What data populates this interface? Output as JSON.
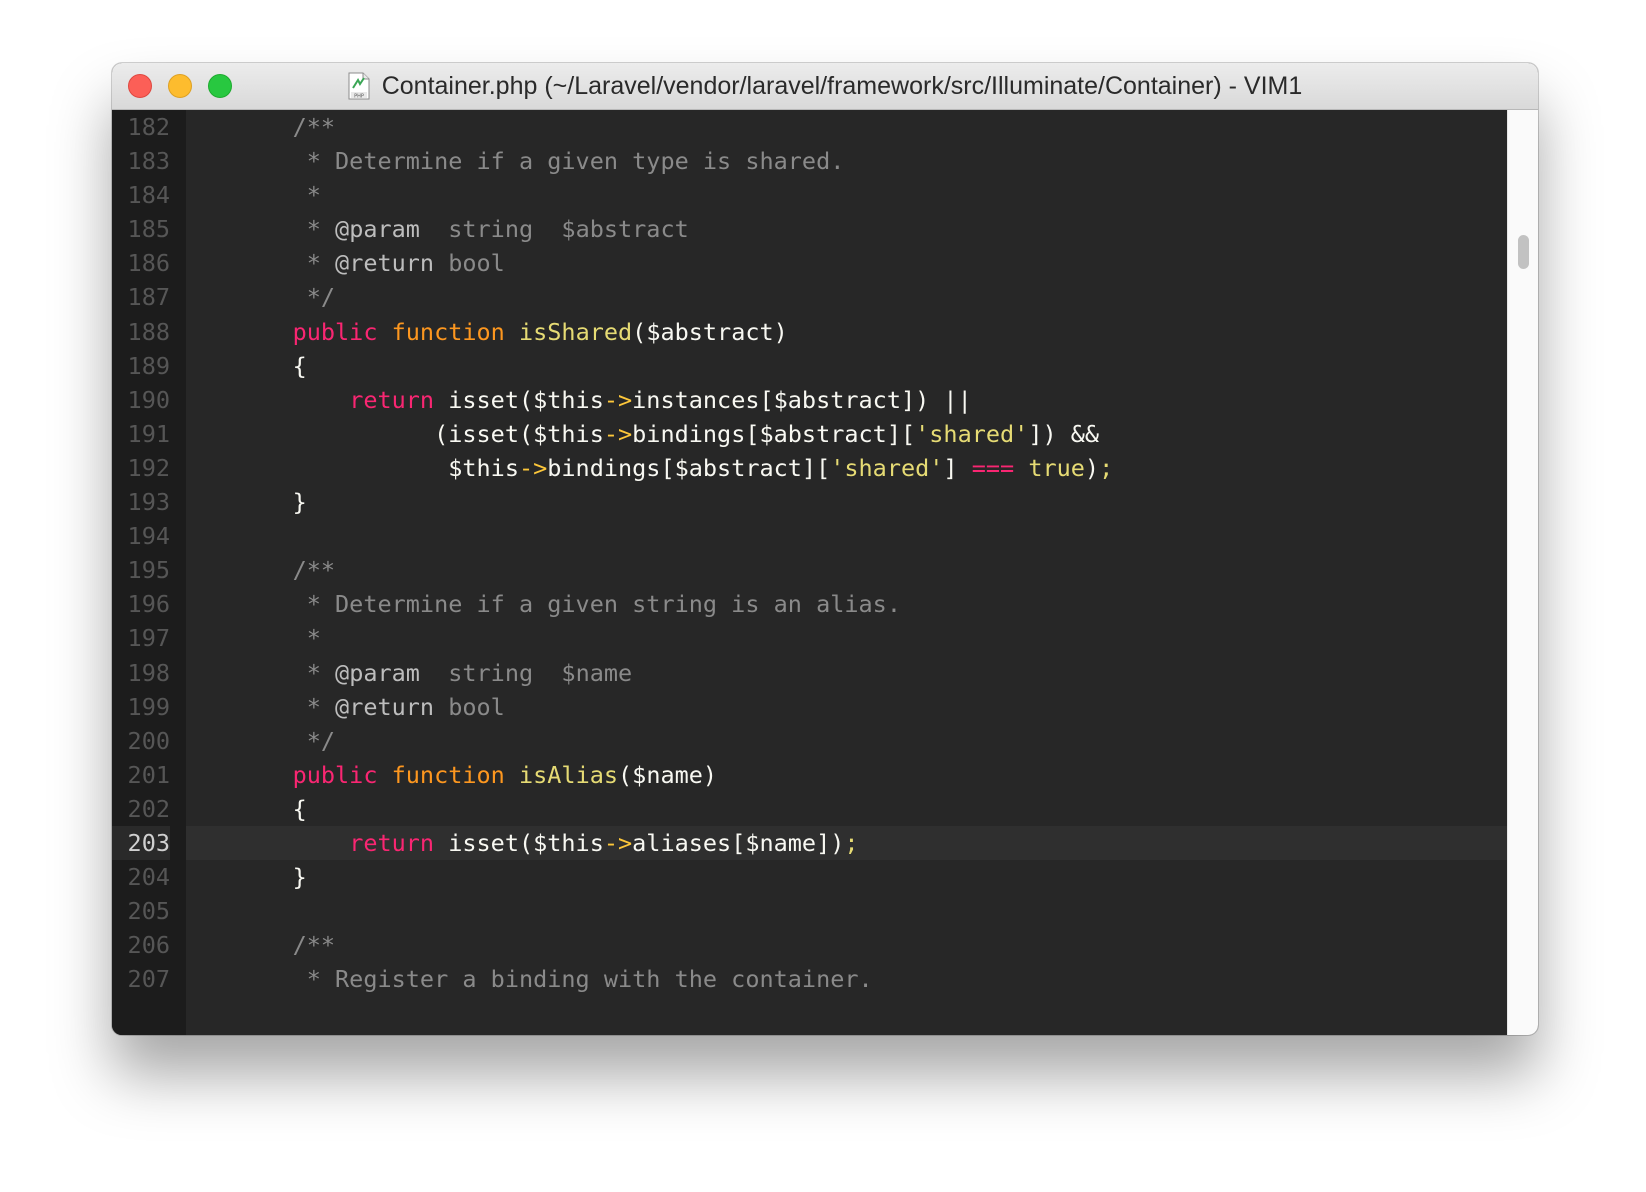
{
  "window": {
    "title": "Container.php (~/Laravel/vendor/laravel/framework/src/Illuminate/Container) - VIM1",
    "file_icon": "php-file-icon"
  },
  "scroll": {
    "position_fraction": 0.14
  },
  "editor": {
    "current_line": 203,
    "lines": [
      {
        "num": "182",
        "tokens": [
          {
            "t": "    /**",
            "c": "comment"
          }
        ]
      },
      {
        "num": "183",
        "tokens": [
          {
            "t": "     * Determine if a given type is shared.",
            "c": "comment"
          }
        ]
      },
      {
        "num": "184",
        "tokens": [
          {
            "t": "     *",
            "c": "comment"
          }
        ]
      },
      {
        "num": "185",
        "tokens": [
          {
            "t": "     * ",
            "c": "comment"
          },
          {
            "t": "@param",
            "c": "doctag"
          },
          {
            "t": "  string  $abstract",
            "c": "comment"
          }
        ]
      },
      {
        "num": "186",
        "tokens": [
          {
            "t": "     * ",
            "c": "comment"
          },
          {
            "t": "@return",
            "c": "doctag"
          },
          {
            "t": " bool",
            "c": "comment"
          }
        ]
      },
      {
        "num": "187",
        "tokens": [
          {
            "t": "     */",
            "c": "comment"
          }
        ]
      },
      {
        "num": "188",
        "tokens": [
          {
            "t": "    ",
            "c": "default"
          },
          {
            "t": "public",
            "c": "keyword"
          },
          {
            "t": " ",
            "c": "default"
          },
          {
            "t": "function",
            "c": "storage"
          },
          {
            "t": " ",
            "c": "default"
          },
          {
            "t": "isShared",
            "c": "funcname"
          },
          {
            "t": "($abstract)",
            "c": "default"
          }
        ]
      },
      {
        "num": "189",
        "tokens": [
          {
            "t": "    {",
            "c": "default"
          }
        ]
      },
      {
        "num": "190",
        "tokens": [
          {
            "t": "        ",
            "c": "default"
          },
          {
            "t": "return",
            "c": "keyword"
          },
          {
            "t": " isset($this",
            "c": "default"
          },
          {
            "t": "->",
            "c": "arrow"
          },
          {
            "t": "instances[$abstract]) ||",
            "c": "default"
          }
        ]
      },
      {
        "num": "191",
        "tokens": [
          {
            "t": "              (isset($this",
            "c": "default"
          },
          {
            "t": "->",
            "c": "arrow"
          },
          {
            "t": "bindings[$abstract][",
            "c": "default"
          },
          {
            "t": "'shared'",
            "c": "string"
          },
          {
            "t": "]) &&",
            "c": "default"
          }
        ]
      },
      {
        "num": "192",
        "tokens": [
          {
            "t": "               $this",
            "c": "default"
          },
          {
            "t": "->",
            "c": "arrow"
          },
          {
            "t": "bindings[$abstract][",
            "c": "default"
          },
          {
            "t": "'shared'",
            "c": "string"
          },
          {
            "t": "] ",
            "c": "default"
          },
          {
            "t": "===",
            "c": "operator"
          },
          {
            "t": " ",
            "c": "default"
          },
          {
            "t": "true",
            "c": "constant"
          },
          {
            "t": ")",
            "c": "default"
          },
          {
            "t": ";",
            "c": "punct-y"
          }
        ]
      },
      {
        "num": "193",
        "tokens": [
          {
            "t": "    }",
            "c": "default"
          }
        ]
      },
      {
        "num": "194",
        "tokens": []
      },
      {
        "num": "195",
        "tokens": [
          {
            "t": "    /**",
            "c": "comment"
          }
        ]
      },
      {
        "num": "196",
        "tokens": [
          {
            "t": "     * Determine if a given string is an alias.",
            "c": "comment"
          }
        ]
      },
      {
        "num": "197",
        "tokens": [
          {
            "t": "     *",
            "c": "comment"
          }
        ]
      },
      {
        "num": "198",
        "tokens": [
          {
            "t": "     * ",
            "c": "comment"
          },
          {
            "t": "@param",
            "c": "doctag"
          },
          {
            "t": "  string  $name",
            "c": "comment"
          }
        ]
      },
      {
        "num": "199",
        "tokens": [
          {
            "t": "     * ",
            "c": "comment"
          },
          {
            "t": "@return",
            "c": "doctag"
          },
          {
            "t": " bool",
            "c": "comment"
          }
        ]
      },
      {
        "num": "200",
        "tokens": [
          {
            "t": "     */",
            "c": "comment"
          }
        ]
      },
      {
        "num": "201",
        "tokens": [
          {
            "t": "    ",
            "c": "default"
          },
          {
            "t": "public",
            "c": "keyword"
          },
          {
            "t": " ",
            "c": "default"
          },
          {
            "t": "function",
            "c": "storage"
          },
          {
            "t": " ",
            "c": "default"
          },
          {
            "t": "isAlias",
            "c": "funcname"
          },
          {
            "t": "($name)",
            "c": "default"
          }
        ]
      },
      {
        "num": "202",
        "tokens": [
          {
            "t": "    {",
            "c": "default"
          }
        ]
      },
      {
        "num": "203",
        "tokens": [
          {
            "t": "        ",
            "c": "default"
          },
          {
            "t": "return",
            "c": "keyword"
          },
          {
            "t": " isset($this",
            "c": "default"
          },
          {
            "t": "->",
            "c": "arrow"
          },
          {
            "t": "aliases[$name])",
            "c": "default"
          },
          {
            "t": ";",
            "c": "punct-y"
          }
        ]
      },
      {
        "num": "204",
        "tokens": [
          {
            "t": "    }",
            "c": "default"
          }
        ]
      },
      {
        "num": "205",
        "tokens": []
      },
      {
        "num": "206",
        "tokens": [
          {
            "t": "    /**",
            "c": "comment"
          }
        ]
      },
      {
        "num": "207",
        "tokens": [
          {
            "t": "     * Register a binding with the container.",
            "c": "comment"
          }
        ]
      }
    ]
  }
}
